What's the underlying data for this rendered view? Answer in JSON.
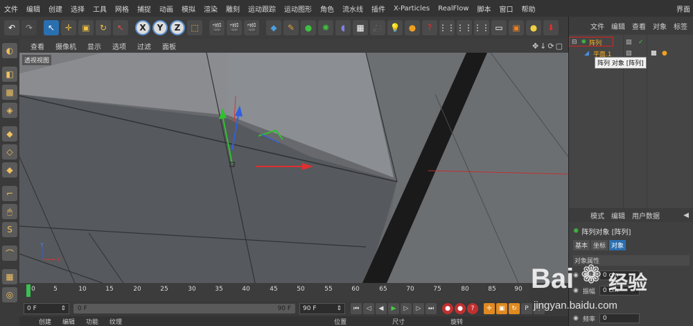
{
  "menu": [
    "文件",
    "编辑",
    "创建",
    "选择",
    "工具",
    "网格",
    "捕捉",
    "动画",
    "模拟",
    "渲染",
    "雕刻",
    "运动跟踪",
    "运动图形",
    "角色",
    "流水线",
    "插件",
    "X-Particles",
    "RealFlow",
    "脚本",
    "窗口",
    "帮助"
  ],
  "menu_right": "界面",
  "toolbar_axes": [
    "X",
    "Y",
    "Z"
  ],
  "viewport": {
    "menu": [
      "查看",
      "摄像机",
      "显示",
      "选项",
      "过滤",
      "面板"
    ],
    "label": "透视视图"
  },
  "timeline": {
    "ticks": [
      "0",
      "5",
      "10",
      "15",
      "20",
      "25",
      "30",
      "35",
      "40",
      "45",
      "50",
      "55",
      "60",
      "65",
      "70",
      "75",
      "80",
      "85",
      "90"
    ],
    "frame_label": "0 F"
  },
  "transport": {
    "current_frame": "0 F",
    "range_start": "0 F",
    "range_end": "90 F",
    "end_frame": "90 F"
  },
  "bottom_tabs": [
    "创建",
    "编辑",
    "功能",
    "纹理"
  ],
  "bottom_attrs": [
    "位置",
    "尺寸",
    "旋转"
  ],
  "object_manager": {
    "menu": [
      "文件",
      "编辑",
      "查看",
      "对象",
      "标签"
    ],
    "objects": [
      {
        "name": "阵列",
        "level": 0
      },
      {
        "name": "平面.1",
        "level": 1
      }
    ],
    "tooltip": "阵列 对象 [阵列]"
  },
  "attribute_manager": {
    "menu": [
      "模式",
      "编辑",
      "用户数据"
    ],
    "title": "阵列对象 [阵列]",
    "tabs": [
      "基本",
      "坐标",
      "对象"
    ],
    "active_tab": "对象",
    "section": "对象属性",
    "rows": [
      {
        "label": "半径",
        "value": "0 cm"
      },
      {
        "label": "振幅",
        "value": "0 cm"
      },
      {
        "label": "频率",
        "value": "0"
      }
    ]
  },
  "watermark": {
    "brand": "Bai",
    "brand2": "经验",
    "url": "jingyan.baidu.com"
  },
  "colors": {
    "accent": "#2a6fb0",
    "object_name": "#ffb020",
    "highlight_box": "#e02020",
    "axis_x": "#e03030",
    "axis_y": "#30c030",
    "axis_z": "#3060e0"
  }
}
